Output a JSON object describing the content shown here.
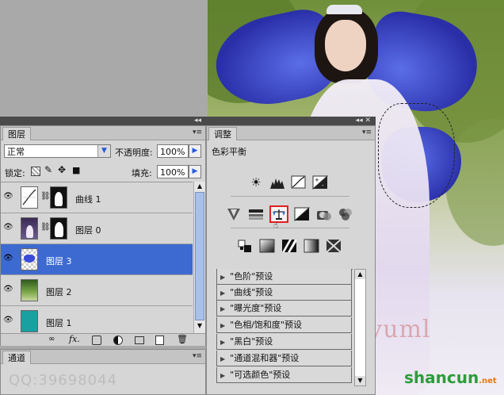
{
  "layers_panel": {
    "tab_label": "图层",
    "blend_mode": "正常",
    "opacity_label": "不透明度:",
    "opacity_value": "100%",
    "lock_label": "锁定:",
    "fill_label": "填充:",
    "fill_value": "100%",
    "layers": [
      {
        "name": "曲线 1",
        "selected": false
      },
      {
        "name": "图层 0",
        "selected": false
      },
      {
        "name": "图层 3",
        "selected": true
      },
      {
        "name": "图层 2",
        "selected": false
      },
      {
        "name": "图层 1",
        "selected": false
      }
    ]
  },
  "channels_panel": {
    "tab_label": "通道"
  },
  "adjustments_panel": {
    "tab_label": "调整",
    "title": "色彩平衡",
    "presets": [
      "\"色阶\"预设",
      "\"曲线\"预设",
      "\"曝光度\"预设",
      "\"色相/饱和度\"预设",
      "\"黑白\"预设",
      "\"通道混和器\"预设",
      "\"可选颜色\"预设"
    ]
  },
  "watermarks": {
    "qq": "QQ:39698044",
    "site": "shancun",
    "site_suffix": ".net",
    "brand": "Xinyuml"
  },
  "colors": {
    "selected_layer": "#3d6ad0",
    "panel_bg": "#d6d6d6",
    "highlight_box": "#e02020"
  }
}
